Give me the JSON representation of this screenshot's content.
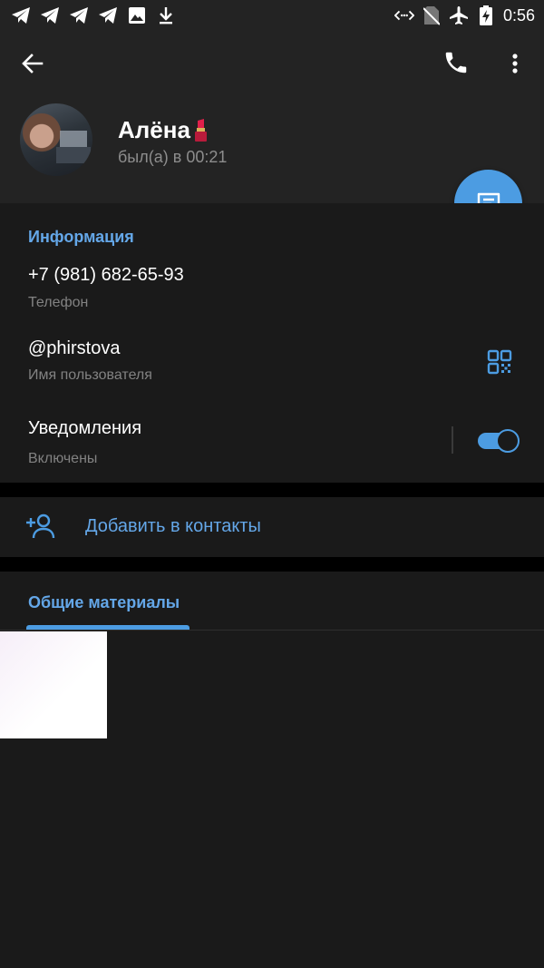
{
  "status_bar": {
    "time": "0:56",
    "left_icons": [
      "telegram-icon",
      "telegram-icon",
      "telegram-icon",
      "telegram-icon",
      "image-icon",
      "download-icon"
    ],
    "right_icons": [
      "data-icon",
      "no-sim-icon",
      "airplane-icon",
      "battery-charging-icon"
    ]
  },
  "header": {
    "name": "Алёна",
    "name_emoji": "lipstick-icon",
    "last_seen": "был(а) в 00:21"
  },
  "info": {
    "title": "Информация",
    "phone": "+7 (981) 682-65-93",
    "phone_label": "Телефон",
    "username": "@phirstova",
    "username_label": "Имя пользователя",
    "notifications": "Уведомления",
    "notifications_label": "Включены",
    "notifications_enabled": true
  },
  "add_contact": {
    "label": "Добавить в контакты"
  },
  "media": {
    "tab_title": "Общие материалы"
  },
  "colors": {
    "accent": "#4c9ce2",
    "accent_text": "#64a7e8",
    "background": "#1a1a1a",
    "header_bg": "#232323",
    "secondary_text": "#828282"
  }
}
